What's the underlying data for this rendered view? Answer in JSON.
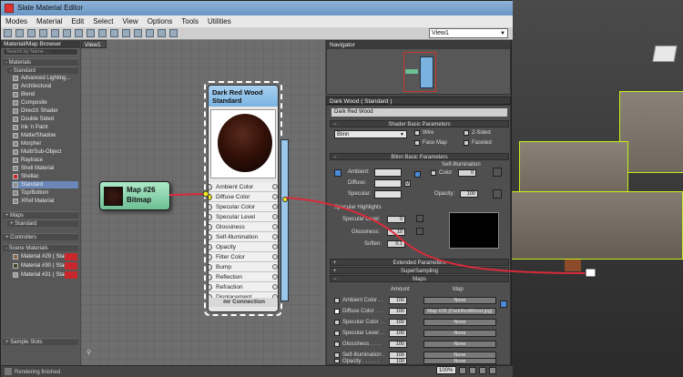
{
  "window": {
    "title": "Slate Material Editor"
  },
  "menu": [
    "Modes",
    "Material",
    "Edit",
    "Select",
    "View",
    "Options",
    "Tools",
    "Utilities"
  ],
  "toolbar": {
    "view_select": "View1"
  },
  "browser": {
    "title": "Material/Map Browser",
    "search_placeholder": "Search by Name ...",
    "materials_header": "- Materials",
    "standard_header": "- Standard",
    "items": [
      "Advanced Lighting...",
      "Architectural",
      "Blend",
      "Composite",
      "DirectX Shader",
      "Double Sided",
      "Ink 'n Paint",
      "Matte/Shadow",
      "Morpher",
      "Multi/Sub-Object",
      "Raytrace",
      "Shell Material",
      "Shellac",
      "Standard",
      "Top/Bottom",
      "XRef Material"
    ],
    "selected_item": "Standard",
    "maps_header": "+ Maps",
    "maps_standard": "+ Standard",
    "controllers_header": "+ Controllers",
    "scene_header": "- Scene Materials",
    "scene_items": [
      {
        "label": "Material #29 ( Stand",
        "color": "#8a6a4a"
      },
      {
        "label": "Material #30 ( Stand",
        "color": "#3a4a2a"
      },
      {
        "label": "Material #31 ( Stand",
        "color": "#9a9a9a"
      }
    ],
    "sample_slots": "+ Sample Slots"
  },
  "view": {
    "tab": "View1"
  },
  "bitmap_node": {
    "title": "Map #26",
    "subtitle": "Bitmap"
  },
  "material_node": {
    "title_line1": "Dark Red Wood",
    "title_line2": "Standard",
    "slots": [
      "Ambient Color",
      "Diffuse Color",
      "Specular Color",
      "Specular Level",
      "Glossiness",
      "Self-Illumination",
      "Opacity",
      "Filter Color",
      "Bump",
      "Reflection",
      "Refraction",
      "Displacement"
    ],
    "connected_slot": "Diffuse Color",
    "mr_connection": "mr Connection"
  },
  "navigator": {
    "title": "Navigator"
  },
  "params": {
    "title": "Dark Wood  ( Standard )",
    "name_field": "Dark Red Wood",
    "shader_basic": "Shader Basic Parameters",
    "shader": "Blinn",
    "wire": "Wire",
    "two_sided": "2-Sided",
    "face_map": "Face Map",
    "faceted": "Faceted",
    "blinn_basic": "Blinn Basic Parameters",
    "self_illum": "Self-Illumination",
    "color": "Color",
    "color_value": "0",
    "ambient": "Ambient:",
    "diffuse": "Diffuse:",
    "specular": "Specular:",
    "opacity": "Opacity:",
    "opacity_value": "100",
    "spec_highlights": "Specular Highlights",
    "spec_level": "Specular Level:",
    "spec_level_value": "0",
    "glossiness": "Glossiness:",
    "glossiness_value": "10",
    "soften": "Soften:",
    "soften_value": "0.1",
    "extended": "Extended Parameters",
    "supersampling": "SuperSampling",
    "maps": "Maps",
    "amount_header": "Amount",
    "map_header": "Map",
    "map_rows": [
      {
        "name": "Ambient Color . .",
        "amount": "100",
        "map": "None",
        "checked": false
      },
      {
        "name": "Diffuse Color . . .",
        "amount": "100",
        "map": "Map #26 (DarkRedWood.jpg)",
        "checked": true
      },
      {
        "name": "Specular Color . .",
        "amount": "100",
        "map": "None",
        "checked": false
      },
      {
        "name": "Specular Level . .",
        "amount": "100",
        "map": "None",
        "checked": false
      },
      {
        "name": "Glossiness . . . .",
        "amount": "100",
        "map": "None",
        "checked": false
      },
      {
        "name": "Self-Illumination .",
        "amount": "100",
        "map": "None",
        "checked": false
      },
      {
        "name": "Opacity . . . . . .",
        "amount": "100",
        "map": "None",
        "checked": false
      }
    ]
  },
  "status": {
    "text": "Rendering finished",
    "zoom": "100%"
  },
  "colors": {
    "wire": "#d92b3a",
    "selection": "#c6f01a"
  }
}
